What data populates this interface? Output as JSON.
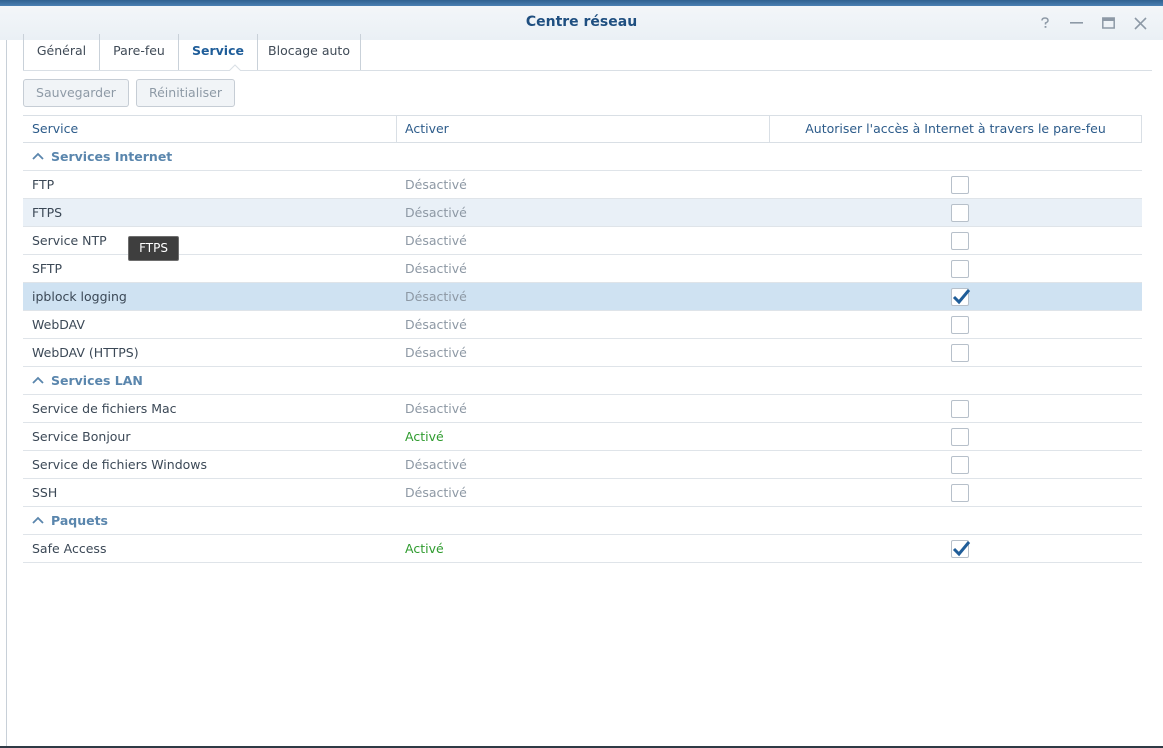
{
  "window": {
    "title": "Centre réseau",
    "controls": [
      "help-icon",
      "minimize-icon",
      "maximize-icon",
      "close-icon"
    ]
  },
  "tabs": [
    {
      "label": "Général",
      "active": false
    },
    {
      "label": "Pare-feu",
      "active": false
    },
    {
      "label": "Service",
      "active": true
    },
    {
      "label": "Blocage auto",
      "active": false
    }
  ],
  "toolbar": {
    "save_label": "Sauvegarder",
    "reset_label": "Réinitialiser"
  },
  "table": {
    "columns": [
      "Service",
      "Activer",
      "Autoriser l'accès à Internet à travers le pare-feu"
    ],
    "groups": [
      {
        "label": "Services Internet",
        "rows": [
          {
            "service": "FTP",
            "status": "Désactivé",
            "allow": false
          },
          {
            "service": "FTPS",
            "status": "Désactivé",
            "allow": false
          },
          {
            "service": "Service NTP",
            "status": "Désactivé",
            "allow": false
          },
          {
            "service": "SFTP",
            "status": "Désactivé",
            "allow": false
          },
          {
            "service": "ipblock logging",
            "status": "Désactivé",
            "allow": true
          },
          {
            "service": "WebDAV",
            "status": "Désactivé",
            "allow": false
          },
          {
            "service": "WebDAV (HTTPS)",
            "status": "Désactivé",
            "allow": false
          }
        ]
      },
      {
        "label": "Services LAN",
        "rows": [
          {
            "service": "Service de fichiers Mac",
            "status": "Désactivé",
            "allow": false
          },
          {
            "service": "Service Bonjour",
            "status": "Activé",
            "allow": false
          },
          {
            "service": "Service de fichiers Windows",
            "status": "Désactivé",
            "allow": false
          },
          {
            "service": "SSH",
            "status": "Désactivé",
            "allow": false
          }
        ]
      },
      {
        "label": "Paquets",
        "rows": [
          {
            "service": "Safe Access",
            "status": "Activé",
            "allow": true
          }
        ]
      }
    ]
  },
  "tooltip": "FTPS",
  "colors": {
    "accent": "#1f5d99",
    "enabled": "#2e9b2e",
    "disabled": "#8d98a4",
    "selected_row": "#cfe2f2",
    "hover_row": "#e9f0f7"
  }
}
